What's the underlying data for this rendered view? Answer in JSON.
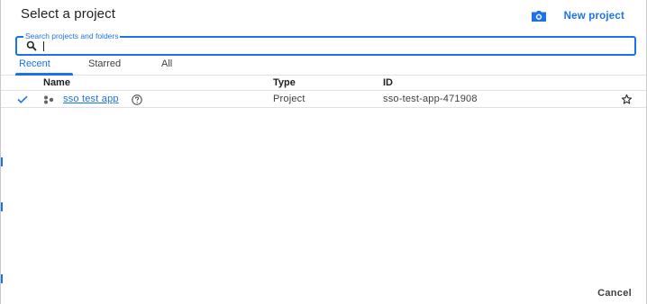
{
  "dialog": {
    "title": "Select a project",
    "new_project_label": "New project",
    "cancel_label": "Cancel"
  },
  "search": {
    "legend": "Search projects and folders",
    "value": "",
    "placeholder": ""
  },
  "tabs": [
    {
      "label": "Recent",
      "active": true
    },
    {
      "label": "Starred",
      "active": false
    },
    {
      "label": "All",
      "active": false
    }
  ],
  "table": {
    "columns": [
      "Name",
      "Type",
      "ID"
    ],
    "rows": [
      {
        "selected": true,
        "name": "sso test app",
        "type": "Project",
        "id": "sso-test-app-471908",
        "starred": false
      }
    ]
  },
  "icons": {
    "new_project": "add-project-icon",
    "search": "search-icon",
    "selected": "check-icon",
    "project": "project-icon",
    "help": "help-icon",
    "star": "star-outline-icon"
  },
  "colors": {
    "accent": "#1a73e8",
    "text": "#202124",
    "divider": "#e0e0e0"
  }
}
